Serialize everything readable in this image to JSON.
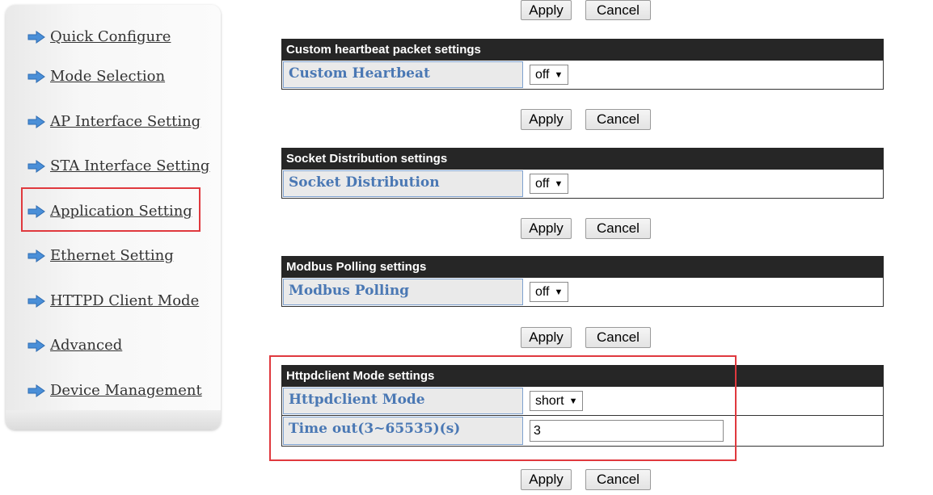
{
  "sidebar": {
    "items": [
      {
        "label": "Quick Configure"
      },
      {
        "label": "Mode Selection"
      },
      {
        "label": "AP Interface Setting"
      },
      {
        "label": "STA Interface Setting"
      },
      {
        "label": "Application Setting"
      },
      {
        "label": "Ethernet Setting"
      },
      {
        "label": "HTTPD Client Mode"
      },
      {
        "label": "Advanced"
      },
      {
        "label": "Device Management"
      }
    ],
    "arrow_icon": "blue-arrow-icon",
    "arrow_color": "#4a8fd8"
  },
  "buttons": {
    "apply": "Apply",
    "cancel": "Cancel"
  },
  "sections": {
    "heartbeat": {
      "title": "Custom heartbeat packet settings",
      "label": "Custom Heartbeat",
      "value": "off"
    },
    "socket": {
      "title": "Socket Distribution settings",
      "label": "Socket Distribution",
      "value": "off"
    },
    "modbus": {
      "title": "Modbus Polling settings",
      "label": "Modbus Polling",
      "value": "off"
    },
    "httpd": {
      "title": "Httpdclient Mode settings",
      "mode_label": "Httpdclient Mode",
      "mode_value": "short",
      "timeout_label": "Time out(3~65535)(s)",
      "timeout_value": "3"
    }
  },
  "colors": {
    "highlight": "#e0393e",
    "label_text": "#4a78b4",
    "header_bg": "#262626"
  }
}
